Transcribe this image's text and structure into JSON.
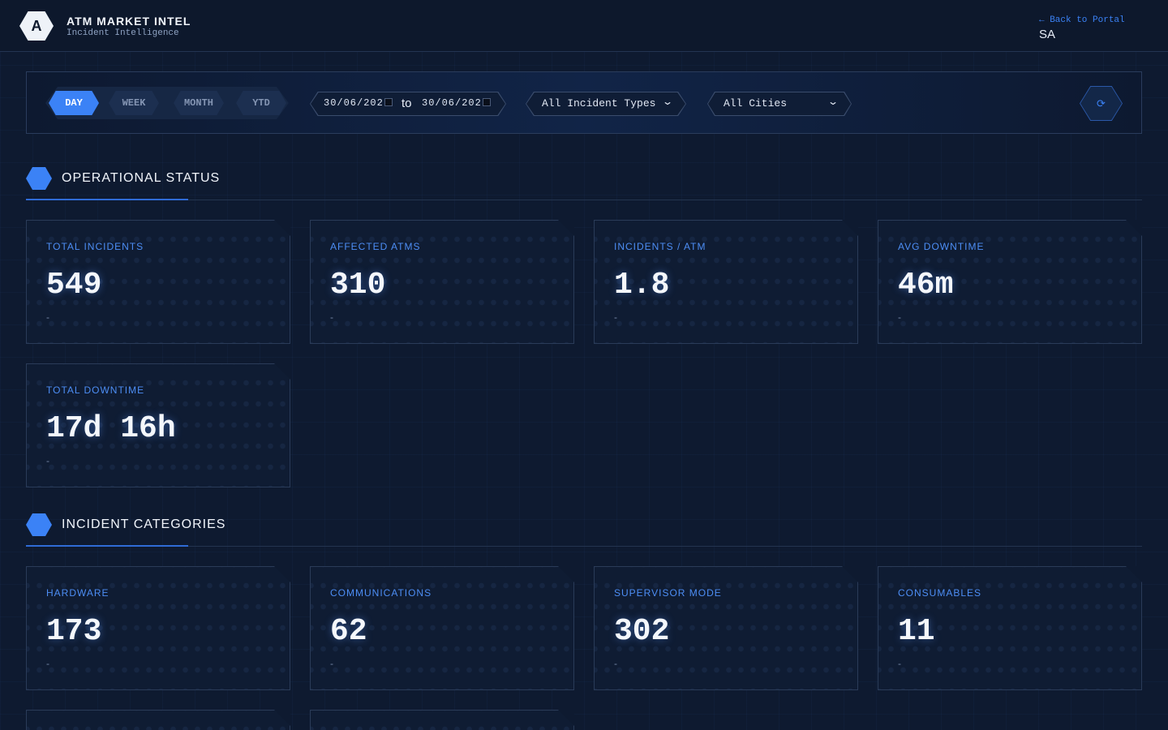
{
  "header": {
    "logo_letter": "A",
    "title": "ATM MARKET INTEL",
    "subtitle": "Incident Intelligence",
    "back_link": "← Back to Portal",
    "user_initials": "SA"
  },
  "filters": {
    "periods": [
      {
        "label": "DAY",
        "active": true
      },
      {
        "label": "WEEK",
        "active": false
      },
      {
        "label": "MONTH",
        "active": false
      },
      {
        "label": "YTD",
        "active": false
      }
    ],
    "date_from": "30/06/202",
    "date_separator": "to",
    "date_to": "30/06/202",
    "incident_type_selected": "All Incident Types",
    "city_selected": "All Cities",
    "refresh_icon": "⟳"
  },
  "sections": {
    "operational_status": {
      "title": "OPERATIONAL STATUS",
      "cards": [
        {
          "label": "TOTAL INCIDENTS",
          "value": "549",
          "sub": "-"
        },
        {
          "label": "AFFECTED ATMS",
          "value": "310",
          "sub": "-"
        },
        {
          "label": "INCIDENTS / ATM",
          "value": "1.8",
          "sub": "-"
        },
        {
          "label": "AVG DOWNTIME",
          "value": "46m",
          "sub": "-"
        },
        {
          "label": "TOTAL DOWNTIME",
          "value": "17d 16h",
          "sub": "-"
        }
      ]
    },
    "incident_categories": {
      "title": "INCIDENT CATEGORIES",
      "cards": [
        {
          "label": "HARDWARE",
          "value": "173",
          "sub": "-"
        },
        {
          "label": "COMMUNICATIONS",
          "value": "62",
          "sub": "-"
        },
        {
          "label": "SUPERVISOR MODE",
          "value": "302",
          "sub": "-"
        },
        {
          "label": "CONSUMABLES",
          "value": "11",
          "sub": "-"
        }
      ]
    }
  },
  "colors": {
    "accent": "#3b82f6",
    "background": "#0e1a30",
    "card_label": "#4d8ef5"
  }
}
